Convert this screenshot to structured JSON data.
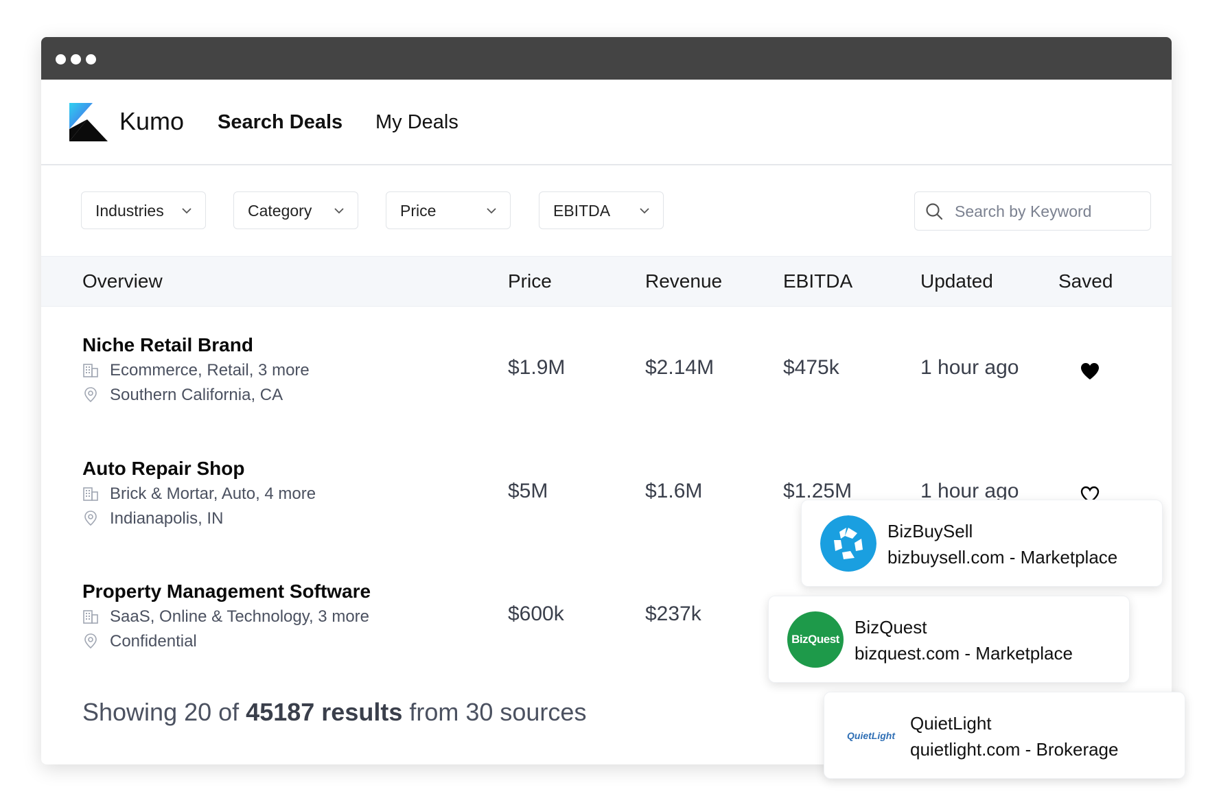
{
  "window": {
    "chrome_dots": 3
  },
  "brand": {
    "name": "Kumo"
  },
  "nav": {
    "search_deals": "Search Deals",
    "my_deals": "My Deals"
  },
  "filters": {
    "industries": "Industries",
    "category": "Category",
    "price": "Price",
    "ebitda": "EBITDA"
  },
  "search": {
    "placeholder": "Search by Keyword"
  },
  "table": {
    "headers": {
      "overview": "Overview",
      "price": "Price",
      "revenue": "Revenue",
      "ebitda": "EBITDA",
      "updated": "Updated",
      "saved": "Saved"
    },
    "rows": [
      {
        "title": "Niche Retail Brand",
        "industries": "Ecommerce, Retail, 3 more",
        "location": "Southern California, CA",
        "price": "$1.9M",
        "revenue": "$2.14M",
        "ebitda": "$475k",
        "updated": "1 hour ago",
        "saved": true
      },
      {
        "title": "Auto Repair Shop",
        "industries": "Brick & Mortar, Auto, 4 more",
        "location": "Indianapolis, IN",
        "price": "$5M",
        "revenue": "$1.6M",
        "ebitda": "$1.25M",
        "updated": "1 hour ago",
        "saved": false
      },
      {
        "title": "Property Management Software",
        "industries": "SaaS, Online & Technology, 3 more",
        "location": "Confidential",
        "price": "$600k",
        "revenue": "$237k",
        "ebitda": "",
        "updated": "",
        "saved": false
      }
    ]
  },
  "footer": {
    "prefix": "Showing 20 of ",
    "count": "45187 results",
    "suffix": " from 30 sources"
  },
  "sources": [
    {
      "name": "BizBuySell",
      "desc": "bizbuysell.com - Marketplace",
      "logo_color": "#1a9fe0"
    },
    {
      "name": "BizQuest",
      "desc": "bizquest.com - Marketplace",
      "logo_text": "BizQuest",
      "logo_color": "#1e9a4a"
    },
    {
      "name": "QuietLight",
      "desc": "quietlight.com - Brokerage",
      "logo_text": "QuietLight",
      "logo_color": "#2f6fb5"
    }
  ],
  "colors": {
    "accent_gradient_start": "#2fd0f0",
    "accent_gradient_end": "#4a5ee8"
  }
}
